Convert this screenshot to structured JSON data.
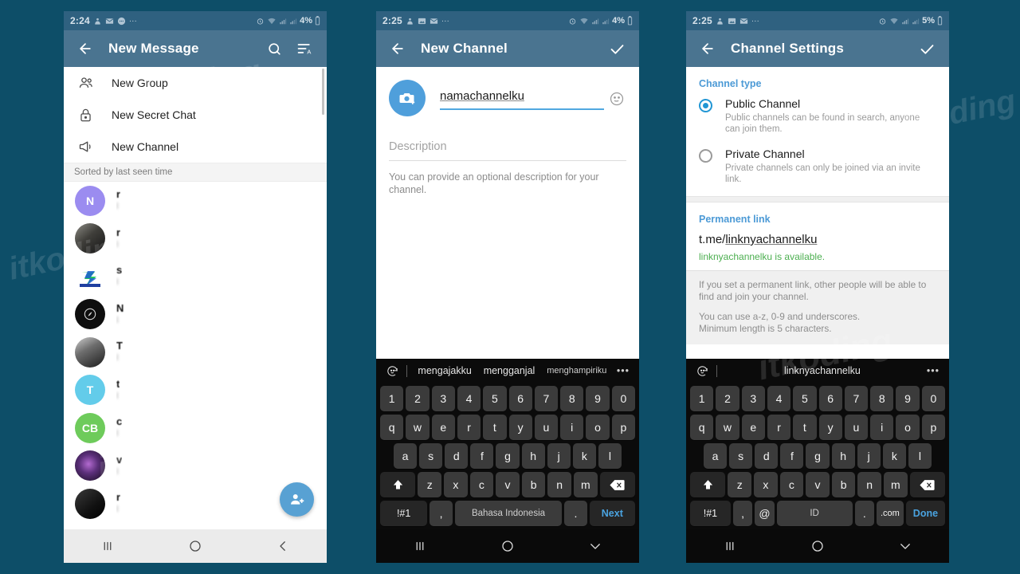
{
  "background_color": "#0d4e68",
  "watermark": "itkoding",
  "phone1": {
    "statusbar": {
      "time": "2:24",
      "battery": "4%",
      "icons": [
        "data-usage-icon",
        "mail-icon",
        "message-icon",
        "more-icon",
        "alarm-icon",
        "wifi-icon",
        "signal-icon",
        "signal2-icon",
        "battery-icon"
      ]
    },
    "appbar": {
      "title": "New Message",
      "back": "back-arrow-icon",
      "search": "search-icon",
      "sort": "sort-by-alpha-icon"
    },
    "menu": [
      {
        "label": "New Group",
        "icon": "group-icon"
      },
      {
        "label": "New Secret Chat",
        "icon": "lock-icon"
      },
      {
        "label": "New Channel",
        "icon": "megaphone-icon"
      }
    ],
    "sorted_label": "Sorted by last seen time",
    "contacts": [
      {
        "initials": "N",
        "color": "#9b8cf0",
        "name": "r",
        "status": "l",
        "photo": false
      },
      {
        "initials": "",
        "color": "#3a3a38",
        "name": "r",
        "status": "l",
        "photo": true
      },
      {
        "initials": "",
        "color": "#ffffff",
        "name": "s",
        "status": "l",
        "photo": true
      },
      {
        "initials": "",
        "color": "#111111",
        "name": "N",
        "status": "l",
        "photo": true
      },
      {
        "initials": "",
        "color": "#5a5a5a",
        "name": "T",
        "status": "l",
        "photo": true
      },
      {
        "initials": "T",
        "color": "#63ccea",
        "name": "t",
        "status": "l",
        "photo": false
      },
      {
        "initials": "CB",
        "color": "#6ecb5b",
        "name": "c",
        "status": "l",
        "photo": false
      },
      {
        "initials": "",
        "color": "#2b1a3a",
        "name": "v",
        "status": "l",
        "photo": true
      },
      {
        "initials": "",
        "color": "#1a1a1a",
        "name": "r",
        "status": "l",
        "photo": true
      }
    ],
    "fab": {
      "icon": "add-person-icon",
      "color": "#58a1d3"
    },
    "navbar": [
      "recents-icon",
      "home-icon",
      "back-icon"
    ]
  },
  "phone2": {
    "statusbar": {
      "time": "2:25",
      "battery": "4%"
    },
    "appbar": {
      "title": "New Channel",
      "back": "back-arrow-icon",
      "confirm": "check-icon"
    },
    "form": {
      "avatar_icon": "camera-add-icon",
      "channel_name": "namachannelku",
      "emoji_icon": "emoji-icon",
      "description_placeholder": "Description",
      "description_hint": "You can provide an optional description for your channel."
    },
    "keyboard": {
      "suggestions": [
        "mengajakku",
        "mengganjal",
        "menghampiriku"
      ],
      "more": "•••",
      "row_numbers": [
        "1",
        "2",
        "3",
        "4",
        "5",
        "6",
        "7",
        "8",
        "9",
        "0"
      ],
      "row_q": [
        "q",
        "w",
        "e",
        "r",
        "t",
        "y",
        "u",
        "i",
        "o",
        "p"
      ],
      "row_a": [
        "a",
        "s",
        "d",
        "f",
        "g",
        "h",
        "j",
        "k",
        "l"
      ],
      "row_z": [
        "z",
        "x",
        "c",
        "v",
        "b",
        "n",
        "m"
      ],
      "shift": "shift-icon",
      "backspace": "backspace-icon",
      "symbols": "!#1",
      "comma": ",",
      "space": "Bahasa Indonesia",
      "period": ".",
      "action": "Next"
    },
    "navbar": [
      "recents-icon",
      "home-icon",
      "chevron-down-icon"
    ]
  },
  "phone3": {
    "statusbar": {
      "time": "2:25",
      "battery": "5%"
    },
    "appbar": {
      "title": "Channel Settings",
      "back": "back-arrow-icon",
      "confirm": "check-icon"
    },
    "settings": {
      "section_channel_type": "Channel type",
      "options": [
        {
          "title": "Public Channel",
          "subtitle": "Public channels can be found in search, anyone can join them.",
          "selected": true
        },
        {
          "title": "Private Channel",
          "subtitle": "Private channels can only be joined via an invite link.",
          "selected": false
        }
      ],
      "section_permanent_link": "Permanent link",
      "link_prefix": "t.me/",
      "link_value": "linknyachannelku",
      "availability": "linknyachannelku is available.",
      "availability_color": "#4caf50",
      "info_1": "If you set a permanent link, other people will be able to find and join your channel.",
      "info_2": "You can use a-z, 0-9 and underscores.\nMinimum length is 5 characters."
    },
    "keyboard": {
      "suggestion": "linknyachannelku",
      "more": "•••",
      "row_numbers": [
        "1",
        "2",
        "3",
        "4",
        "5",
        "6",
        "7",
        "8",
        "9",
        "0"
      ],
      "row_q": [
        "q",
        "w",
        "e",
        "r",
        "t",
        "y",
        "u",
        "i",
        "o",
        "p"
      ],
      "row_a": [
        "a",
        "s",
        "d",
        "f",
        "g",
        "h",
        "j",
        "k",
        "l"
      ],
      "row_z": [
        "z",
        "x",
        "c",
        "v",
        "b",
        "n",
        "m"
      ],
      "shift": "shift-icon",
      "backspace": "backspace-icon",
      "symbols": "!#1",
      "comma": ",",
      "at": "@",
      "space": "ID",
      "period": ".",
      "dotcom": ".com",
      "action": "Done"
    },
    "navbar": [
      "recents-icon",
      "home-icon",
      "chevron-down-icon"
    ]
  }
}
